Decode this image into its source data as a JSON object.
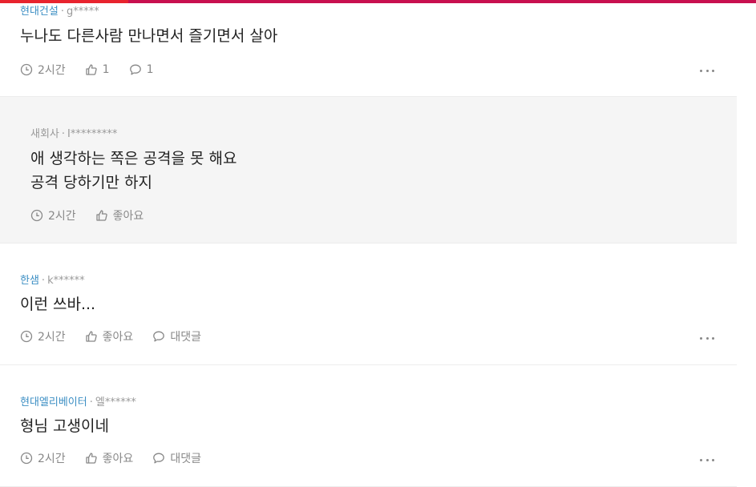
{
  "comments": [
    {
      "company": "현대건설",
      "author": "g*****",
      "body": [
        "누나도 다른사람 만나면서 즐기면서 살아"
      ],
      "time": "2시간",
      "like": "1",
      "reply": "1"
    },
    {
      "company": "새회사",
      "author": "I*********",
      "body": [
        "애 생각하는 쪽은 공격을 못 해요",
        "공격 당하기만 하지"
      ],
      "time": "2시간",
      "like": "좋아요"
    },
    {
      "company": "한샘",
      "author": "k******",
      "body": [
        "이런 쓰바..."
      ],
      "time": "2시간",
      "like": "좋아요",
      "reply": "대댓글"
    },
    {
      "company": "현대엘리베이터",
      "author": "엘******",
      "body": [
        "형님 고생이네"
      ],
      "time": "2시간",
      "like": "좋아요",
      "reply": "대댓글"
    }
  ],
  "meta_separator": "·",
  "icons": {
    "time": "clock-icon",
    "like": "thumbs-up-icon",
    "reply": "speech-bubble-icon",
    "more": "more-horizontal-icon"
  },
  "colors": {
    "accent_bar": "#c8104f",
    "company_link": "#3d8fc4",
    "reply_background": "#f5f5f5"
  }
}
